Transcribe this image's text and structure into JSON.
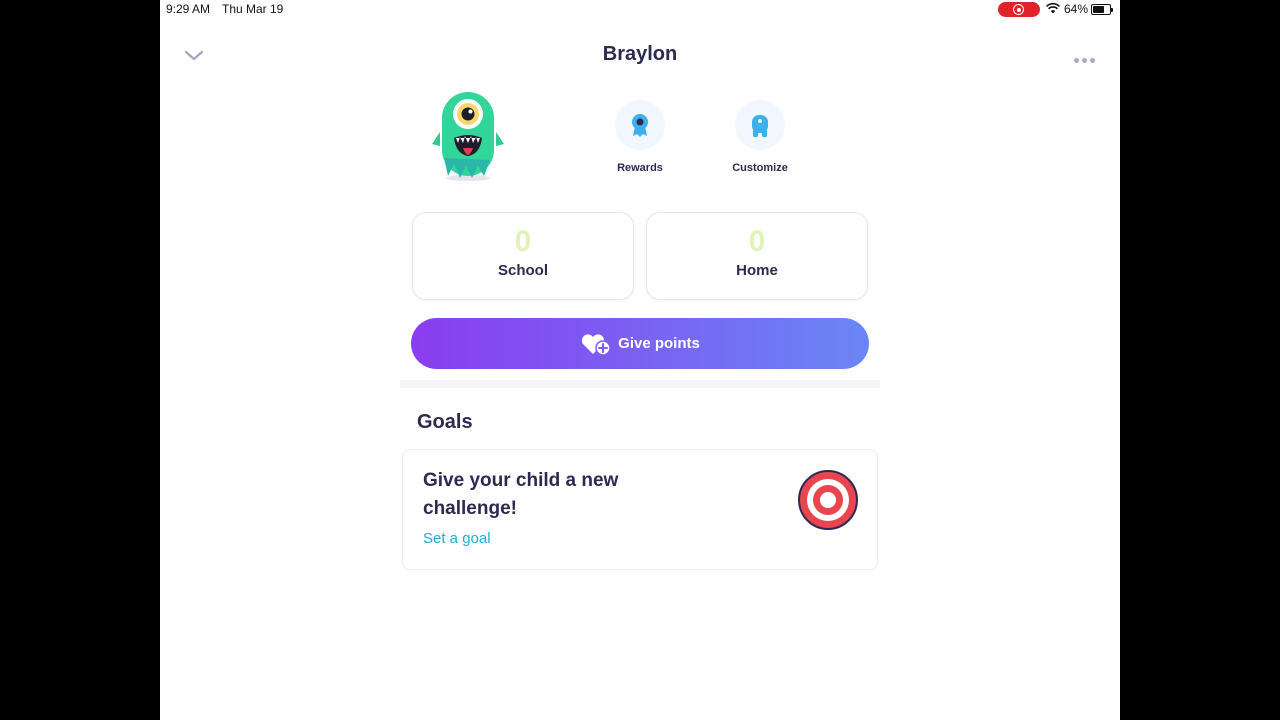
{
  "status_bar": {
    "time": "9:29 AM",
    "date": "Thu Mar 19",
    "battery": "64%",
    "recording_color": "#e0232a"
  },
  "header": {
    "title": "Braylon",
    "back_icon": "chevron-down-icon",
    "more_icon": "more-dots-icon"
  },
  "actions": [
    {
      "label": "Rewards",
      "icon": "rewards-ribbon-icon"
    },
    {
      "label": "Customize",
      "icon": "customize-monster-icon"
    }
  ],
  "points": {
    "school": {
      "value": "0",
      "label": "School"
    },
    "home": {
      "value": "0",
      "label": "Home"
    }
  },
  "give_points": {
    "label": "Give points",
    "icon": "heart-plus-icon"
  },
  "goals": {
    "heading": "Goals",
    "card_title": "Give your child a new challenge!",
    "link": "Set a goal",
    "icon": "target-icon"
  },
  "colors": {
    "title": "#2c2a50",
    "accent_link": "#1ab1d4",
    "gradient_start": "#8a3cf0",
    "gradient_end": "#6a86f6",
    "icon_blue": "#3bb0ea"
  }
}
